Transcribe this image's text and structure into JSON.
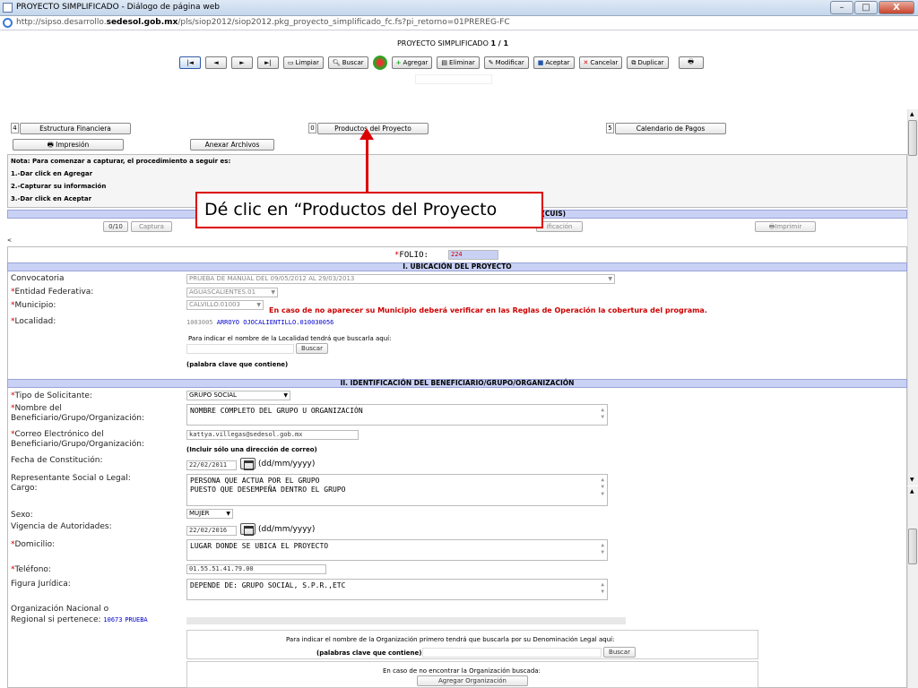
{
  "window": {
    "title": "PROYECTO SIMPLIFICADO - Diálogo de página web",
    "url_prefix": "http://sipso.desarrollo.",
    "url_domain": "sedesol.gob.mx",
    "url_suffix": "/pls/siop2012/siop2012.pkg_proyecto_simplificado_fc.fs?pi_retorno=01PREREG-FC",
    "minimize": "–",
    "maximize": "□",
    "close": "X"
  },
  "header": {
    "title": "PROYECTO SIMPLIFICADO",
    "page": "1 / 1"
  },
  "toolbar": {
    "first": "|◄",
    "prev": "◄",
    "next": "►",
    "last": "►|",
    "limpiar": "Limpiar",
    "buscar": "Buscar",
    "agregar": "Agregar",
    "eliminar": "Eliminar",
    "modificar": "Modificar",
    "aceptar": "Aceptar",
    "cancelar": "Cancelar",
    "duplicar": "Duplicar"
  },
  "sections": {
    "estructura_num": "4",
    "estructura": "Estructura Financiera",
    "productos_num": "0",
    "productos": "Productos del Proyecto",
    "calendario_num": "5",
    "calendario": "Calendario de Pagos",
    "impresion": "Impresión",
    "anexar": "Anexar Archivos"
  },
  "note": {
    "line1": "Nota: Para comenzar a capturar, el procedimiento a seguir es:",
    "line2": "1.-Dar click en Agregar",
    "line3": "2.-Capturar su información",
    "line4": "3.-Dar click en Aceptar"
  },
  "cuis_bar": "A (CUIS)",
  "sub": {
    "counter": "0/10",
    "captura": "Captura",
    "verificacion": "ificación",
    "imprimir": "Imprimir"
  },
  "callout": "Dé clic en “Productos del Proyecto",
  "form": {
    "folio_label": "FOLIO:",
    "folio_value": "224",
    "section1": "I. UBICACIÓN DEL PROYECTO",
    "convocatoria_label": "Convocatoria",
    "convocatoria_value": "PRUEBA DE MANUAL DEL 09/05/2012 AL 29/03/2013",
    "entidad_label": "Entidad Federativa:",
    "entidad_value": "AGUASCALIENTES.01",
    "municipio_label": "Municipio:",
    "municipio_value": "CALVILLO.01003",
    "municipio_warning": "En caso de no aparecer su Municipio deberá verificar en las Reglas de Operación la cobertura del programa.",
    "localidad_label": "Localidad:",
    "localidad_code": "1003005",
    "localidad_value": "ARROYO OJOCALIENTILLO.010030056",
    "localidad_hint": "Para indicar el nombre de la Localidad tendrá que buscarla aquí:",
    "buscar": "Buscar",
    "palabra_clave": "(palabra clave que contiene)",
    "section2": "II. IDENTIFICACIÓN DEL BENEFICIARIO/GRUPO/ORGANIZACIÓN",
    "tipo_label": "Tipo de Solicitante:",
    "tipo_value": "GRUPO SOCIAL",
    "nombre_label1": "Nombre del",
    "nombre_label2": "Beneficiario/Grupo/Organización:",
    "nombre_value": "NOMBRE COMPLETO DEL GRUPO U ORGANIZACIÓN",
    "correo_label1": "Correo Electrónico del",
    "correo_label2": "Beneficiario/Grupo/Organización:",
    "correo_value": "kattya.villegas@sedesol.gob.mx",
    "correo_hint": "(Incluir sólo una dirección de correo)",
    "fecha_label": "Fecha de Constitución:",
    "fecha_value": "22/02/2011",
    "date_fmt": "(dd/mm/yyyy)",
    "rep_label": "Representante Social o Legal:",
    "cargo_label": "Cargo:",
    "rep_value": "PERSONA QUE ACTUA POR EL GRUPO",
    "cargo_value": "PUESTO QUE DESEMPEÑA DENTRO EL GRUPO",
    "sexo_label": "Sexo:",
    "sexo_value": "MUJER",
    "vigencia_label": "Vigencia de Autoridades:",
    "vigencia_value": "22/02/2016",
    "domicilio_label": "Domicilio:",
    "domicilio_value": "LUGAR DONDE SE UBICA EL PROYECTO",
    "telefono_label": "Teléfono:",
    "telefono_value": "01.55.51.41.79.00",
    "figura_label": "Figura Jurídica:",
    "figura_value": "DEPENDE DE: GRUPO SOCIAL, S.P.R.,ETC",
    "org_label1": "Organización Nacional o",
    "org_label2": "Regional si pertenece:",
    "org_code": "10673",
    "org_value": "PRUEBA",
    "org_hint": "Para indicar el nombre de la Organización primero tendrá que buscarla por su Denominación Legal aquí:",
    "org_palabras": "(palabras clave que contiene)",
    "org_notfound": "En caso de no encontrar la Organización buscada:",
    "agregar_org": "Agregar Organización",
    "asterisk": "*"
  }
}
